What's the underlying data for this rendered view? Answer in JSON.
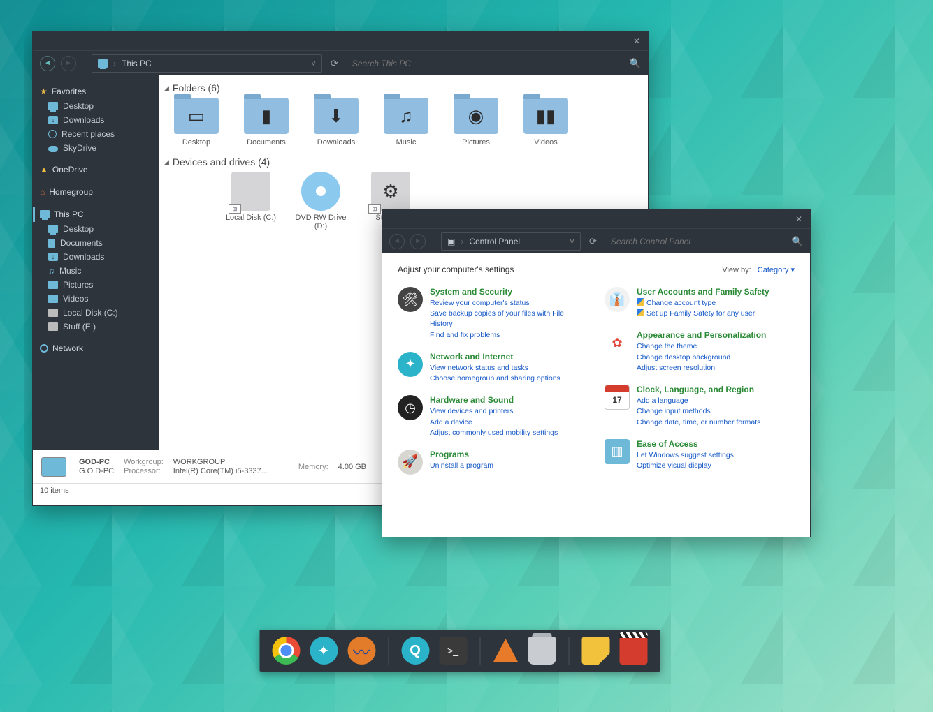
{
  "explorer": {
    "address": "This PC",
    "search_placeholder": "Search This PC",
    "sidebar": {
      "favorites": {
        "label": "Favorites",
        "items": [
          "Desktop",
          "Downloads",
          "Recent places",
          "SkyDrive"
        ]
      },
      "onedrive": "OneDrive",
      "homegroup": "Homegroup",
      "thispc": {
        "label": "This PC",
        "items": [
          "Desktop",
          "Documents",
          "Downloads",
          "Music",
          "Pictures",
          "Videos",
          "Local Disk (C:)",
          "Stuff (E:)"
        ]
      },
      "network": "Network"
    },
    "folders_header": "Folders (6)",
    "folders": [
      "Desktop",
      "Documents",
      "Downloads",
      "Music",
      "Pictures",
      "Videos"
    ],
    "drives_header": "Devices and drives (4)",
    "drives": [
      {
        "name": "Local Disk (C:)"
      },
      {
        "name": "DVD RW Drive (D:)"
      },
      {
        "name": "Stuff (E:)"
      }
    ],
    "details": {
      "name": "GOD-PC",
      "domain": "G.O.D-PC",
      "workgroup_label": "Workgroup:",
      "workgroup": "WORKGROUP",
      "processor_label": "Processor:",
      "processor": "Intel(R) Core(TM) i5-3337...",
      "memory_label": "Memory:",
      "memory": "4.00 GB"
    },
    "status": "10 items"
  },
  "cpanel": {
    "address": "Control Panel",
    "search_placeholder": "Search Control Panel",
    "heading": "Adjust your computer's settings",
    "viewby_label": "View by:",
    "viewby_value": "Category",
    "cats_left": [
      {
        "title": "System and Security",
        "links": [
          "Review your computer's status",
          "Save backup copies of your files with File History",
          "Find and fix problems"
        ]
      },
      {
        "title": "Network and Internet",
        "links": [
          "View network status and tasks",
          "Choose homegroup and sharing options"
        ]
      },
      {
        "title": "Hardware and Sound",
        "links": [
          "View devices and printers",
          "Add a device",
          "Adjust commonly used mobility settings"
        ]
      },
      {
        "title": "Programs",
        "links": [
          "Uninstall a program"
        ]
      }
    ],
    "cats_right": [
      {
        "title": "User Accounts and Family Safety",
        "links": [
          "Change account type",
          "Set up Family Safety for any user"
        ],
        "shield": true
      },
      {
        "title": "Appearance and Personalization",
        "links": [
          "Change the theme",
          "Change desktop background",
          "Adjust screen resolution"
        ]
      },
      {
        "title": "Clock, Language, and Region",
        "links": [
          "Add a language",
          "Change input methods",
          "Change date, time, or number formats"
        ]
      },
      {
        "title": "Ease of Access",
        "links": [
          "Let Windows suggest settings",
          "Optimize visual display"
        ]
      }
    ],
    "calendar_day": "17"
  },
  "dock": [
    "chrome",
    "safari",
    "firefox",
    "|",
    "qt",
    "terminal",
    "|",
    "vlc",
    "trash",
    "|",
    "notes",
    "clapper"
  ]
}
